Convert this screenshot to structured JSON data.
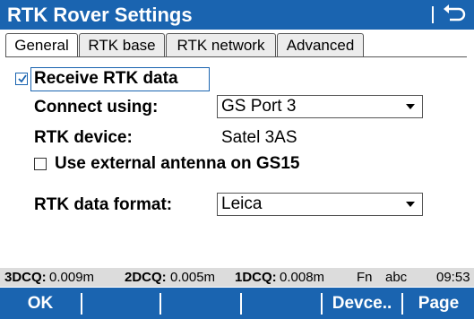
{
  "window": {
    "title": "RTK Rover Settings",
    "back_icon": "return-arrow-icon"
  },
  "tabs": [
    {
      "label": "General",
      "active": true
    },
    {
      "label": "RTK base",
      "active": false
    },
    {
      "label": "RTK network",
      "active": false
    },
    {
      "label": "Advanced",
      "active": false
    }
  ],
  "form": {
    "receive_rtk": {
      "label": "Receive RTK data",
      "checked": true
    },
    "connect_using": {
      "label": "Connect using:",
      "value": "GS Port 3"
    },
    "rtk_device": {
      "label": "RTK device:",
      "value": "Satel 3AS"
    },
    "external_antenna": {
      "label": "Use external antenna on GS15",
      "checked": false
    },
    "rtk_data_format": {
      "label": "RTK data format:",
      "value": "Leica"
    }
  },
  "status": {
    "dcq3_label": "3DCQ:",
    "dcq3_value": "0.009m",
    "dcq2_label": "2DCQ:",
    "dcq2_value": "0.005m",
    "dcq1_label": "1DCQ:",
    "dcq1_value": "0.008m",
    "fn": "Fn",
    "input_mode": "abc",
    "time": "09:53"
  },
  "softkeys": {
    "f1": "OK",
    "f2": "",
    "f3": "",
    "f4": "",
    "f5": "Devce..",
    "f6": "Page"
  },
  "colors": {
    "accent": "#1a64b0",
    "status_bg": "#dcdcdc"
  }
}
